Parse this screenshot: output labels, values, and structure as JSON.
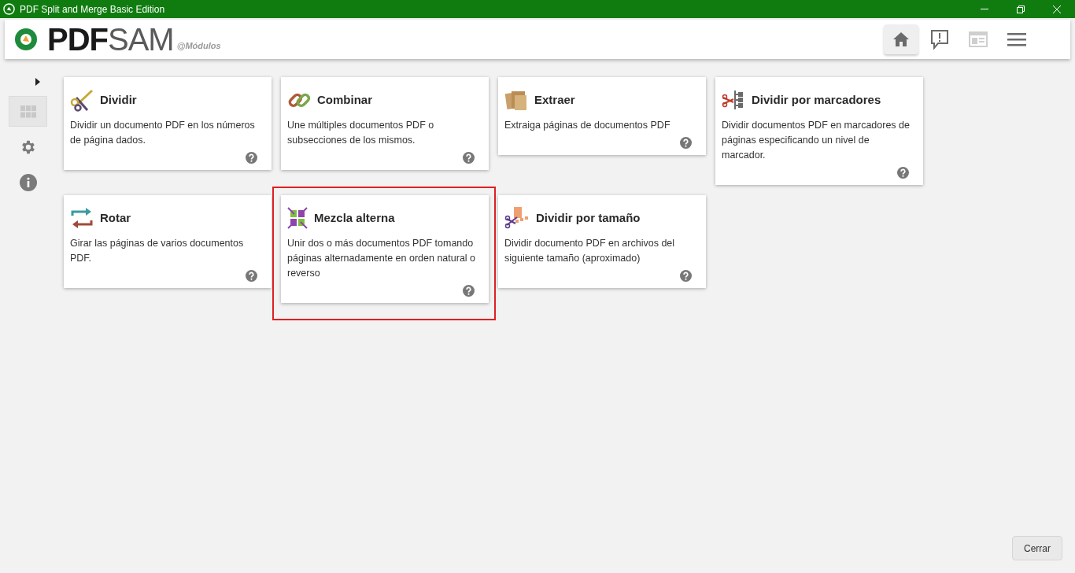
{
  "window": {
    "title": "PDF Split and Merge Basic Edition"
  },
  "header": {
    "logo_dark": "PDF",
    "logo_light": "SAM",
    "subtitle": "@Módulos",
    "nav": [
      {
        "kind": "home",
        "selected": true
      },
      {
        "kind": "feedback",
        "selected": false
      },
      {
        "kind": "news",
        "selected": false
      },
      {
        "kind": "menu",
        "selected": false
      }
    ]
  },
  "sidebar": {
    "items": [
      {
        "kind": "modules",
        "selected": true
      },
      {
        "kind": "settings",
        "selected": false
      },
      {
        "kind": "info",
        "selected": false
      }
    ]
  },
  "modules": [
    {
      "kind": "split",
      "title": "Dividir",
      "description": "Dividir un documento PDF en los números de página dados.",
      "highlighted": false
    },
    {
      "kind": "merge",
      "title": "Combinar",
      "description": "Une múltiples documentos PDF o subsecciones de los mismos.",
      "highlighted": false
    },
    {
      "kind": "extract",
      "title": "Extraer",
      "description": "Extraiga páginas de documentos PDF",
      "highlighted": false
    },
    {
      "kind": "bookmarks",
      "title": "Dividir por marcadores",
      "description": "Dividir documentos PDF en marcadores de páginas especificando un nivel de marcador.",
      "highlighted": false
    },
    {
      "kind": "rotate",
      "title": "Rotar",
      "description": "Girar las páginas de varios documentos PDF.",
      "highlighted": false
    },
    {
      "kind": "alternate",
      "title": "Mezcla alterna",
      "description": "Unir dos o más documentos PDF tomando páginas alternadamente en orden natural o reverso",
      "highlighted": true
    },
    {
      "kind": "size",
      "title": "Dividir por tamaño",
      "description": "Dividir documento PDF en archivos del siguiente tamaño (aproximado)",
      "highlighted": false
    }
  ],
  "footer": {
    "close_button": "Cerrar"
  }
}
